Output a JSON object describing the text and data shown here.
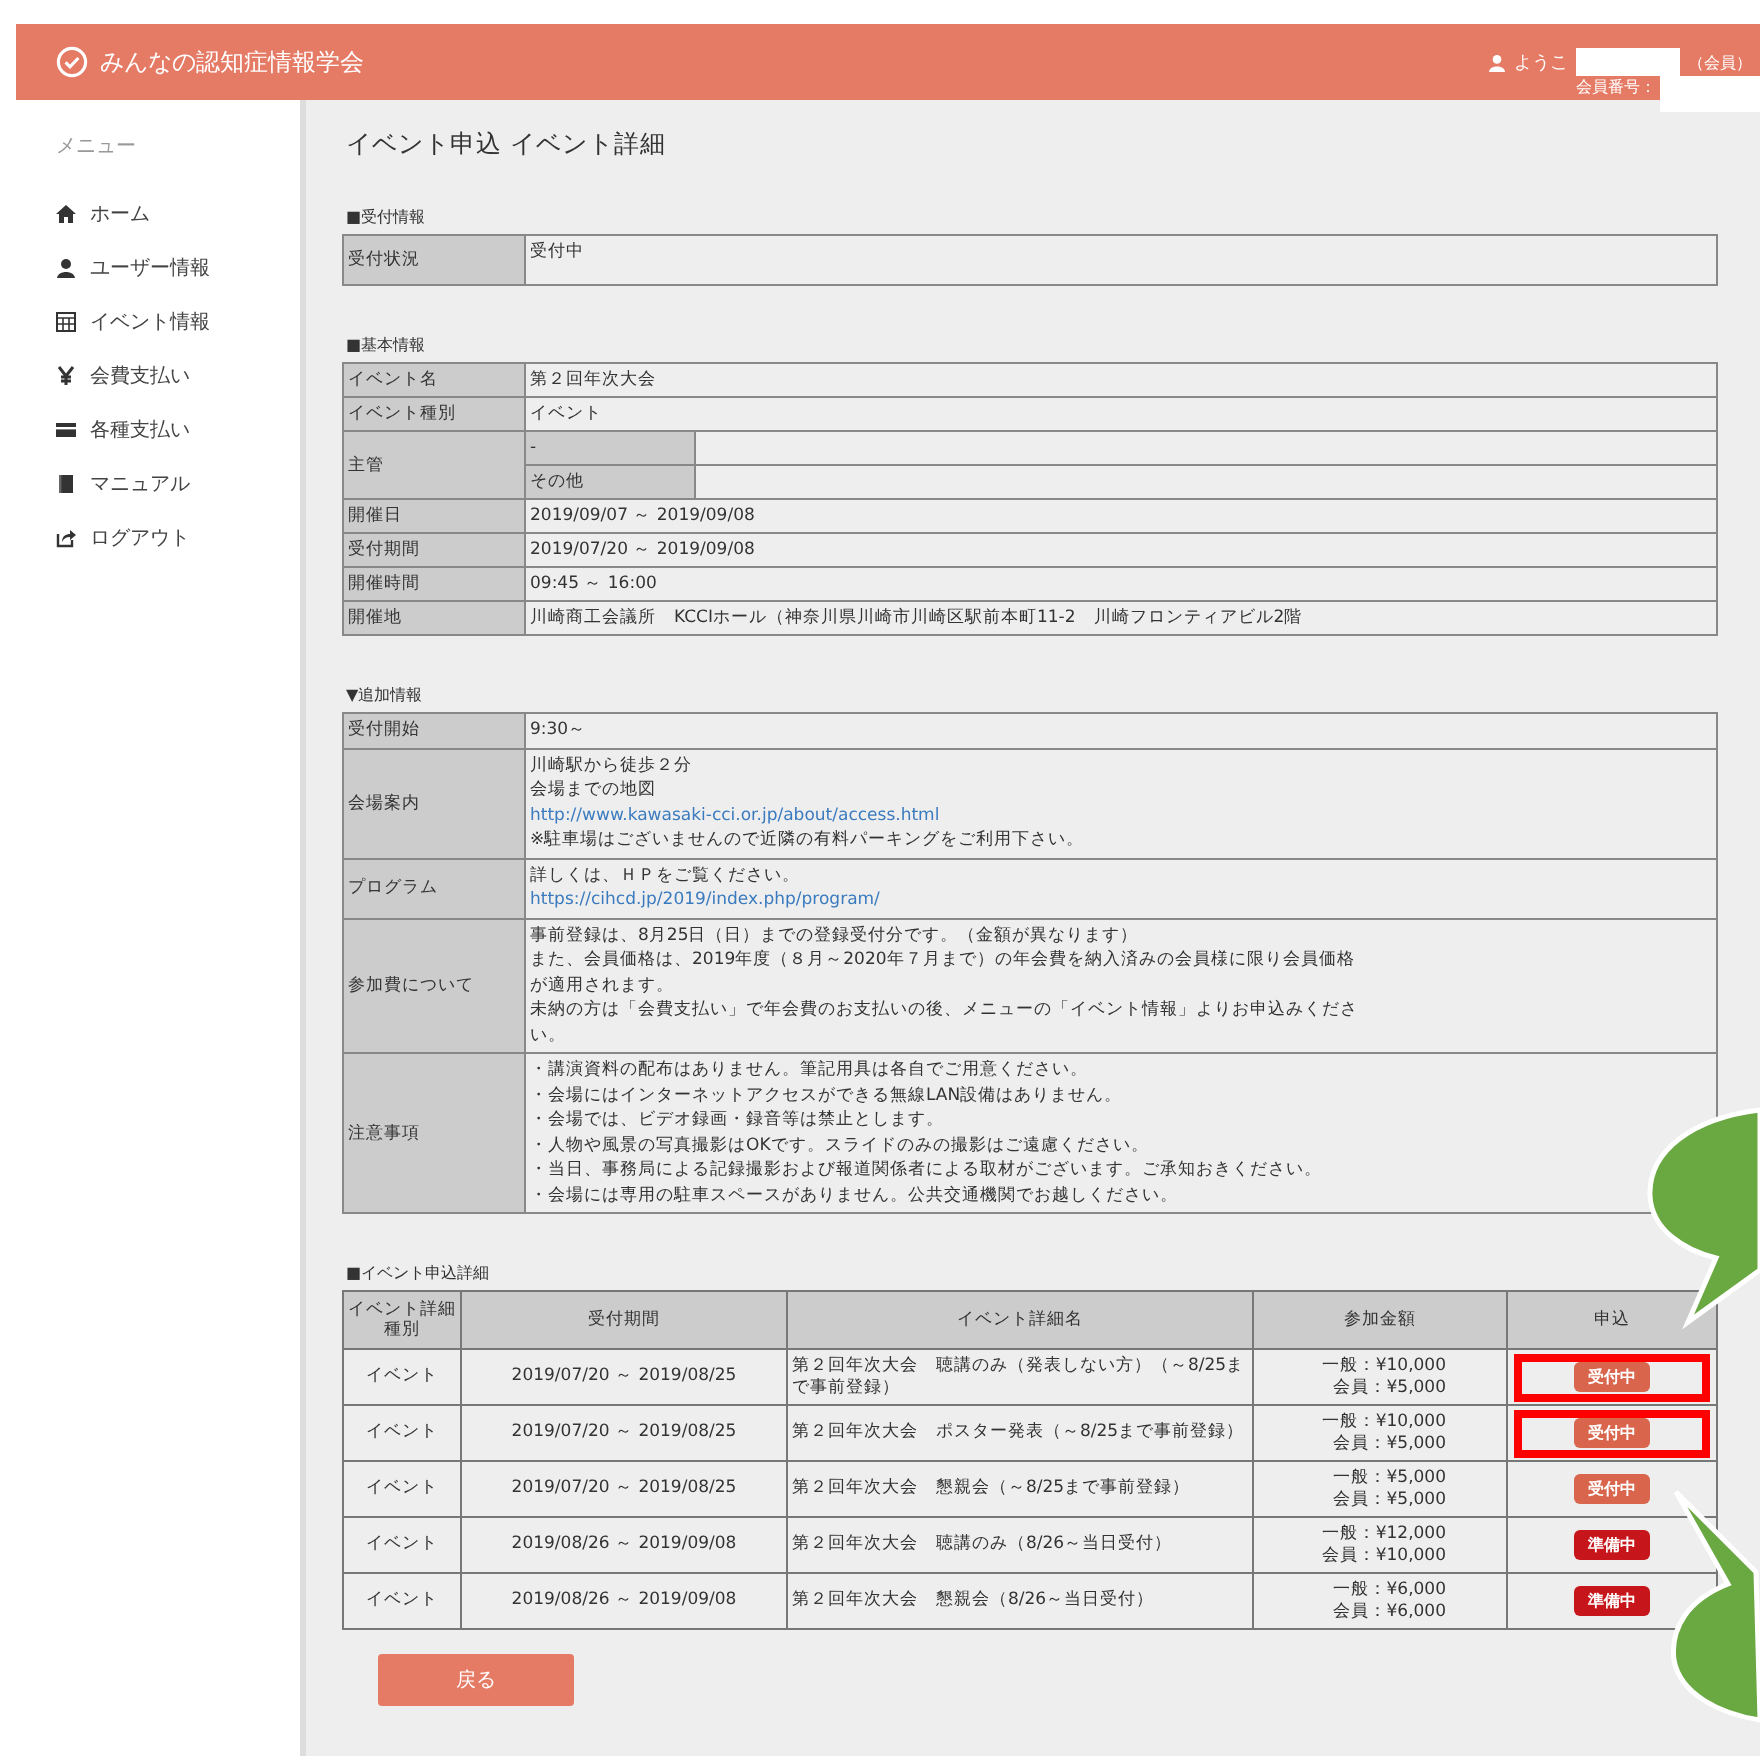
{
  "header": {
    "site_title": "みんなの認知症情報学会",
    "welcome": "ようこ",
    "member_role": "（会員）",
    "member_number_label": "会員番号："
  },
  "sidebar": {
    "heading": "メニュー",
    "items": [
      {
        "label": "ホーム",
        "kind": "home"
      },
      {
        "label": "ユーザー情報",
        "kind": "user"
      },
      {
        "label": "イベント情報",
        "kind": "calendar"
      },
      {
        "label": "会費支払い",
        "kind": "yen"
      },
      {
        "label": "各種支払い",
        "kind": "card"
      },
      {
        "label": "マニュアル",
        "kind": "book"
      },
      {
        "label": "ログアウト",
        "kind": "logout"
      }
    ]
  },
  "page_title": "イベント申込 イベント詳細",
  "reception": {
    "heading": "■受付情報",
    "rows": [
      {
        "label": "受付状況",
        "value": "受付中"
      }
    ]
  },
  "basic": {
    "heading": "■基本情報",
    "rows": [
      {
        "kind": "text",
        "label": "イベント名",
        "value": "第２回年次大会"
      },
      {
        "kind": "text",
        "label": "イベント種別",
        "value": "イベント"
      },
      {
        "kind": "sub",
        "label": "主管",
        "subs": [
          "-",
          "その他"
        ]
      },
      {
        "kind": "text",
        "label": "開催日",
        "value": "2019/09/07 ～ 2019/09/08"
      },
      {
        "kind": "text",
        "label": "受付期間",
        "value": "2019/07/20 ～ 2019/09/08"
      },
      {
        "kind": "text",
        "label": "開催時間",
        "value": "09:45 ～ 16:00"
      },
      {
        "kind": "text",
        "label": "開催地",
        "value": "川崎商工会議所　KCCIホール（神奈川県川崎市川崎区駅前本町11-2　川崎フロンティアビル2階"
      }
    ]
  },
  "extra": {
    "heading": "▼追加情報",
    "rows": [
      {
        "label": "受付開始",
        "lines": [
          {
            "text": "9:30～",
            "link": false
          }
        ]
      },
      {
        "label": "会場案内",
        "lines": [
          {
            "text": "川崎駅から徒歩２分",
            "link": false
          },
          {
            "text": "会場までの地図",
            "link": false
          },
          {
            "text": "http://www.kawasaki-cci.or.jp/about/access.html",
            "link": true
          },
          {
            "text": "※駐車場はございませんので近隣の有料パーキングをご利用下さい。",
            "link": false
          }
        ]
      },
      {
        "label": "プログラム",
        "lines": [
          {
            "text": "詳しくは、ＨＰをご覧ください。",
            "link": false
          },
          {
            "text": "https://cihcd.jp/2019/index.php/program/",
            "link": true
          }
        ]
      },
      {
        "label": "参加費について",
        "lines": [
          {
            "text": "事前登録は、8月25日（日）までの登録受付分です。（金額が異なります）",
            "link": false
          },
          {
            "text": "また、会員価格は、2019年度（８月～2020年７月まで）の年会費を納入済みの会員様に限り会員価格",
            "link": false
          },
          {
            "text": "が適用されます。",
            "link": false
          },
          {
            "text": "未納の方は「会費支払い」で年会費のお支払いの後、メニューの「イベント情報」よりお申込みくださ",
            "link": false
          },
          {
            "text": "い。",
            "link": false
          }
        ]
      },
      {
        "label": "注意事項",
        "lines": [
          {
            "text": "・講演資料の配布はありません。筆記用具は各自でご用意ください。",
            "link": false
          },
          {
            "text": "・会場にはインターネットアクセスができる無線LAN設備はありません。",
            "link": false
          },
          {
            "text": "・会場では、ビデオ録画・録音等は禁止とします。",
            "link": false
          },
          {
            "text": "・人物や風景の写真撮影はOKです。スライドのみの撮影はご遠慮ください。",
            "link": false
          },
          {
            "text": "・当日、事務局による記録撮影および報道関係者による取材がございます。ご承知おきください。",
            "link": false
          },
          {
            "text": "・会場には専用の駐車スペースがありません。公共交通機関でお越しください。",
            "link": false
          }
        ]
      }
    ]
  },
  "events": {
    "heading": "■イベント申込詳細",
    "columns": [
      "イベント詳細種別",
      "受付期間",
      "イベント詳細名",
      "参加金額",
      "申込"
    ],
    "rows": [
      {
        "type": "イベント",
        "period": "2019/07/20 ～ 2019/08/25",
        "name": "第２回年次大会　聴講のみ（発表しない方）（～8/25まで事前登録）",
        "fees": [
          "一般：¥10,000",
          "会員：¥5,000"
        ],
        "status": "受付中",
        "kind": "open",
        "highlighted": true
      },
      {
        "type": "イベント",
        "period": "2019/07/20 ～ 2019/08/25",
        "name": "第２回年次大会　ポスター発表（～8/25まで事前登録）",
        "fees": [
          "一般：¥10,000",
          "会員：¥5,000"
        ],
        "status": "受付中",
        "kind": "open",
        "highlighted": true
      },
      {
        "type": "イベント",
        "period": "2019/07/20 ～ 2019/08/25",
        "name": "第２回年次大会　懇親会（～8/25まで事前登録）",
        "fees": [
          "一般：¥5,000",
          "会員：¥5,000"
        ],
        "status": "受付中",
        "kind": "open",
        "highlighted": false
      },
      {
        "type": "イベント",
        "period": "2019/08/26 ～ 2019/09/08",
        "name": "第２回年次大会　聴講のみ（8/26～当日受付）",
        "fees": [
          "一般：¥12,000",
          "会員：¥10,000"
        ],
        "status": "準備中",
        "kind": "preparing",
        "highlighted": false
      },
      {
        "type": "イベント",
        "period": "2019/08/26 ～ 2019/09/08",
        "name": "第２回年次大会　懇親会（8/26～当日受付）",
        "fees": [
          "一般：¥6,000",
          "会員：¥6,000"
        ],
        "status": "準備中",
        "kind": "preparing",
        "highlighted": false
      }
    ]
  },
  "back_button": "戻る"
}
